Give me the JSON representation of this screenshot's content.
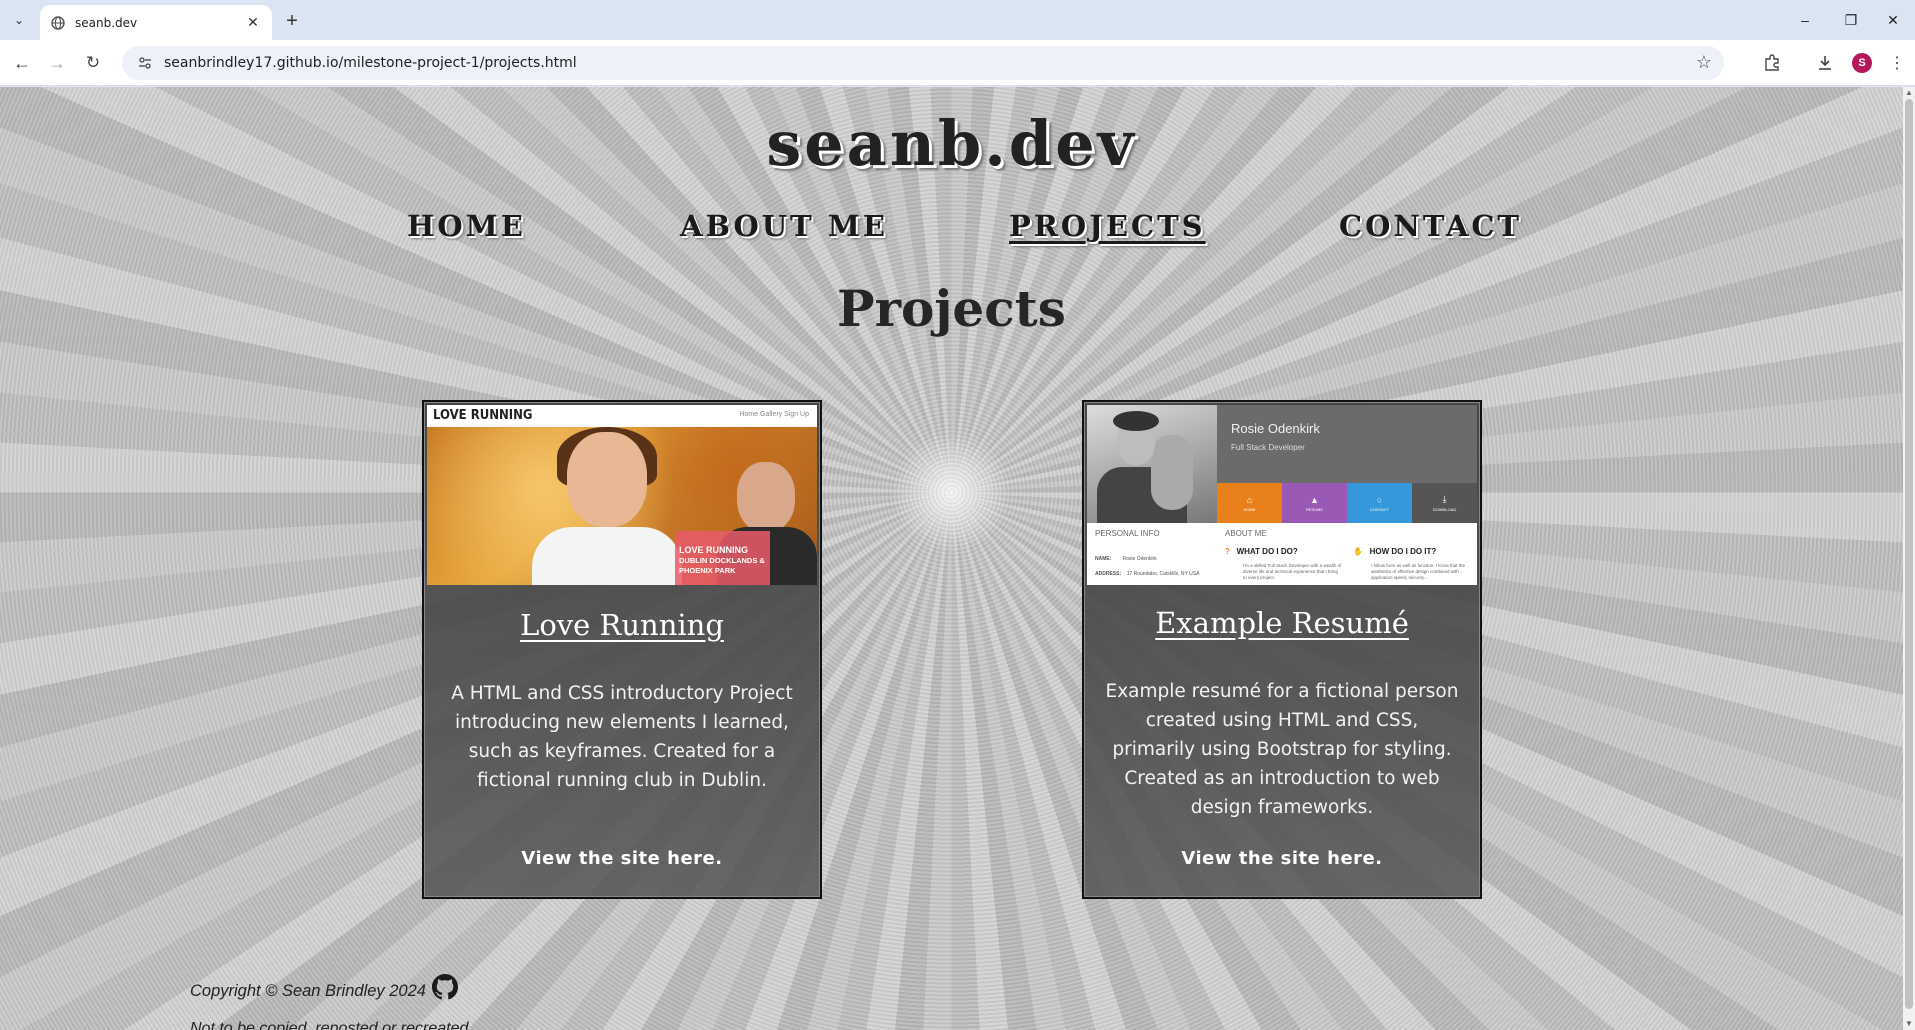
{
  "browser": {
    "tab_title": "seanb.dev",
    "url": "seanbrindley17.github.io/milestone-project-1/projects.html",
    "profile_initial": "S"
  },
  "site": {
    "title": "seanb.dev",
    "nav": [
      "HOME",
      "ABOUT ME",
      "PROJECTS",
      "CONTACT"
    ],
    "active_nav": "PROJECTS",
    "heading": "Projects"
  },
  "projects": [
    {
      "title": "Love Running",
      "description": "A HTML and CSS introductory Project introducing new elements I learned, such as keyframes. Created for a fictional running club in Dublin.",
      "link": "View the site here.",
      "thumb": {
        "logo": "LOVE RUNNING",
        "menu": "Home   Gallery   Sign Up",
        "banner_line1": "LOVE RUNNING",
        "banner_line2": "DUBLIN DOCKLANDS &",
        "banner_line3": "PHOENIX PARK"
      }
    },
    {
      "title": "Example Resumé",
      "description": "Example resumé for a fictional person created using HTML and CSS, primarily using Bootstrap for styling. Created as an introduction to web design frameworks.",
      "link": "View the site here.",
      "thumb": {
        "name": "Rosie Odenkirk",
        "role": "Full Stack Developer",
        "tabs": [
          "HOME",
          "RESUME",
          "CONTACT",
          "DOWNLOAD"
        ],
        "tab_colors": [
          "#e8811c",
          "#9b59b6",
          "#3498db",
          "#555555"
        ],
        "personal_info": "PERSONAL INFO",
        "pi_name_label": "NAME:",
        "pi_name_value": "Rosie Odenkirk",
        "pi_address_label": "ADDRESS:",
        "pi_address_value": "17 Roundabo, Catskills, NY USA",
        "about": "ABOUT ME",
        "q1": "WHAT DO I DO?",
        "q2": "HOW DO I DO IT?",
        "a1": "I'm a skilled Full Stack Developer with a wealth of diverse life and technical experience that I bring to every project.",
        "a2": "I follow form as well as function. I know that the aesthetics of effective design combined with application speed, security..."
      }
    }
  ],
  "footer": {
    "copyright": "Copyright © Sean Brindley 2024",
    "note": "Not to be copied, reposted or recreated"
  }
}
